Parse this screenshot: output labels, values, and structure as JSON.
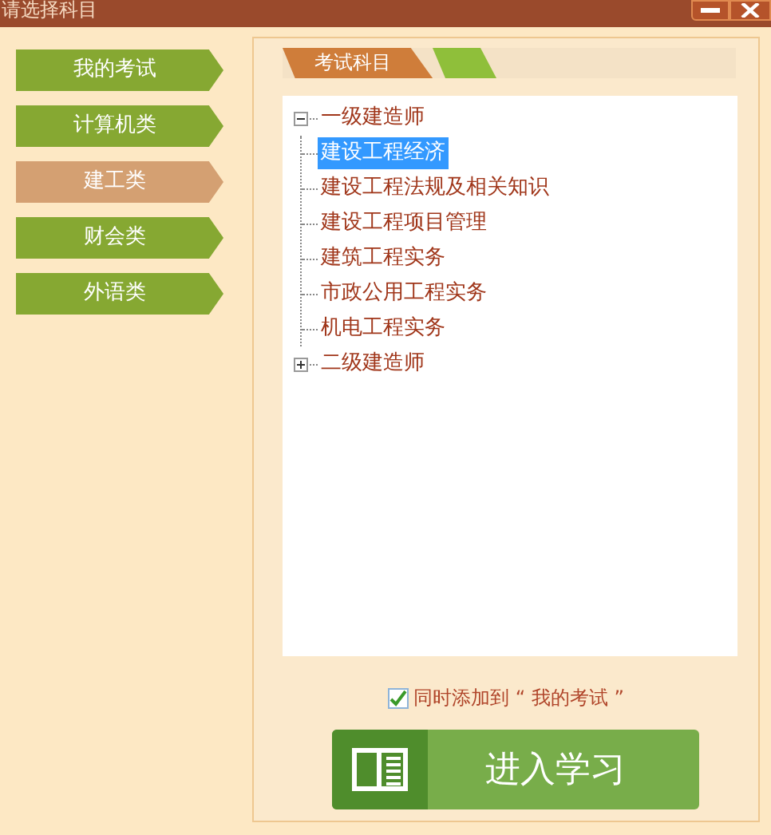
{
  "window": {
    "title": "请选择科目"
  },
  "sidebar": {
    "items": [
      {
        "label": "我的考试",
        "selected": false
      },
      {
        "label": "计算机类",
        "selected": false
      },
      {
        "label": "建工类",
        "selected": true
      },
      {
        "label": "财会类",
        "selected": false
      },
      {
        "label": "外语类",
        "selected": false
      }
    ]
  },
  "tabs": [
    {
      "label": "考试科目",
      "selected": true
    },
    {
      "selected": false
    }
  ],
  "tree": [
    {
      "label": "一级建造师",
      "expanded": true,
      "children": [
        {
          "label": "建设工程经济",
          "selected": true
        },
        {
          "label": "建设工程法规及相关知识",
          "selected": false
        },
        {
          "label": "建设工程项目管理",
          "selected": false
        },
        {
          "label": "建筑工程实务",
          "selected": false
        },
        {
          "label": "市政公用工程实务",
          "selected": false
        },
        {
          "label": "机电工程实务",
          "selected": false
        }
      ]
    },
    {
      "label": "二级建造师",
      "expanded": false
    }
  ],
  "add_to_my_exams": {
    "label": "同时添加到 “ 我的考试 ”",
    "checked": true
  },
  "start_button": {
    "label": "进入学习"
  }
}
